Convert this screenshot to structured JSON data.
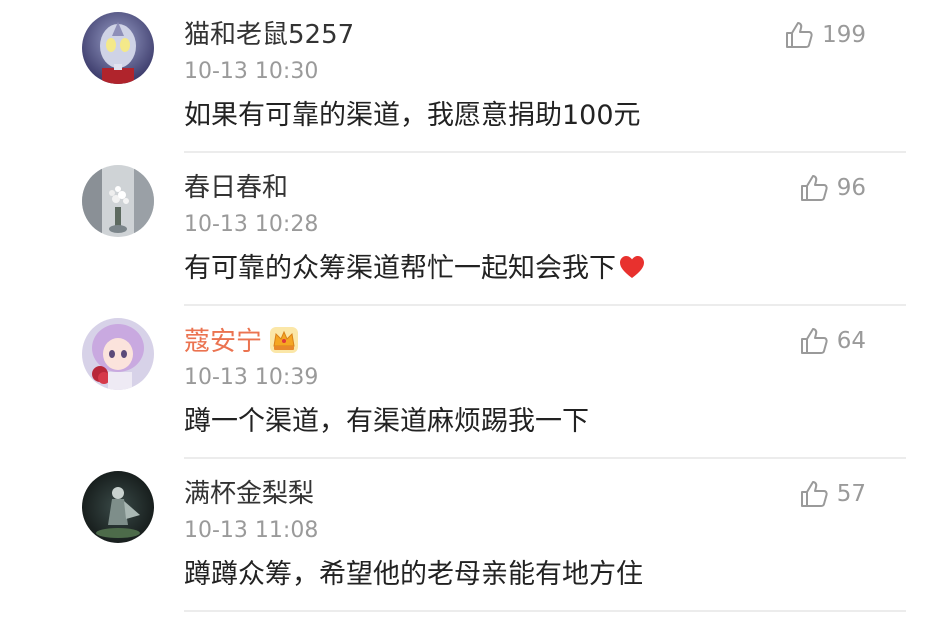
{
  "comments": [
    {
      "username": "猫和老鼠5257",
      "timestamp": "10-13 10:30",
      "content": "如果有可靠的渠道，我愿意捐助100元",
      "likes": "199",
      "avatar_icon": "ultraman-avatar",
      "vip": false
    },
    {
      "username": "春日春和",
      "timestamp": "10-13 10:28",
      "content": "有可靠的众筹渠道帮忙一起知会我下",
      "content_emoji": "heart",
      "likes": "96",
      "avatar_icon": "flower-vase-avatar",
      "vip": false
    },
    {
      "username": "蔻安宁",
      "timestamp": "10-13 10:39",
      "content": "蹲一个渠道，有渠道麻烦踢我一下",
      "likes": "64",
      "avatar_icon": "anime-girl-avatar",
      "vip": true,
      "badge_icon": "crown-icon"
    },
    {
      "username": "满杯金梨梨",
      "timestamp": "10-13 11:08",
      "content": "蹲蹲众筹，希望他的老母亲能有地方住",
      "likes": "57",
      "avatar_icon": "dark-figure-avatar",
      "vip": false
    }
  ],
  "colors": {
    "username": "#333333",
    "vip_username": "#eb7350",
    "timestamp": "#9a9a9a",
    "content": "#222222",
    "like": "#9a9a9a",
    "heart": "#e8312e"
  }
}
